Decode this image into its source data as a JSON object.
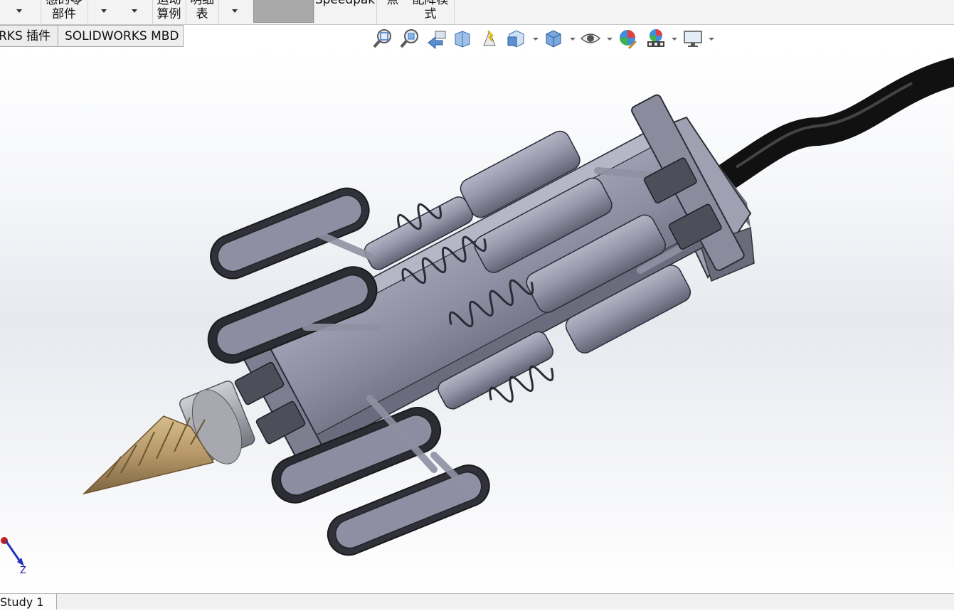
{
  "ribbon": {
    "items": [
      {
        "line1": "",
        "line2": "",
        "caret": true
      },
      {
        "line1": "感的零",
        "line2": "部件"
      },
      {
        "line1": "",
        "line2": "",
        "caret": true
      },
      {
        "line1": "",
        "line2": "",
        "caret": true
      },
      {
        "line1": "运动",
        "line2": "算例"
      },
      {
        "line1": "明细",
        "line2": "表"
      },
      {
        "line1": "",
        "line2": "",
        "caret": true
      },
      {
        "line1": "Speedpak",
        "line2": ""
      },
      {
        "line1": "点",
        "line2": ""
      },
      {
        "line1": "配降模",
        "line2": "式"
      }
    ]
  },
  "tabs": [
    {
      "label": "RKS 插件"
    },
    {
      "label": "SOLIDWORKS MBD"
    }
  ],
  "heads_up_toolbar": {
    "icons": [
      "zoom-to-fit-icon",
      "zoom-to-area-icon",
      "previous-view-icon",
      "section-view-icon",
      "dynamic-annotation-views-icon",
      "view-orientation-icon",
      "display-style-icon",
      "hide-show-items-icon",
      "edit-appearance-icon",
      "apply-scene-icon",
      "view-settings-icon"
    ]
  },
  "viewport": {
    "triad_axis_label": "Z",
    "model": "pipe-crawler-robot-assembly"
  },
  "bottom_bar": {
    "tab_label": "Study 1"
  },
  "colors": {
    "ribbon_bg": "#f3f3f3",
    "model_body": "#8e8fa3",
    "drill_bit": "#b79a6b",
    "cable": "#1f1f1f"
  }
}
